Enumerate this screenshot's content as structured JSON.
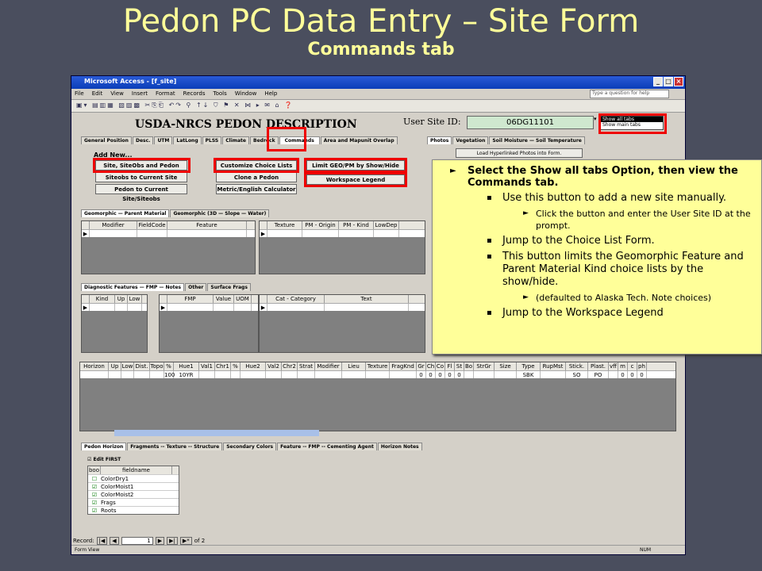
{
  "slide": {
    "title": "Pedon PC Data Entry – Site Form",
    "subtitle": "Commands tab"
  },
  "window": {
    "title": "Microsoft Access - [f_site]",
    "ask_placeholder": "Type a question for help"
  },
  "menu": [
    "File",
    "Edit",
    "View",
    "Insert",
    "Format",
    "Records",
    "Tools",
    "Window",
    "Help"
  ],
  "form": {
    "heading": "USDA-NRCS PEDON DESCRIPTION",
    "user_site_label": "User Site ID:",
    "user_site_value": "06DG11101",
    "tab_options": [
      "Show all tabs",
      "Show main tabs"
    ]
  },
  "tabs": [
    "General Position",
    "Desc.",
    "UTM",
    "LatLong",
    "PLSS",
    "Climate",
    "Bedrock",
    "Commands",
    "Area and Mapunit Overlap"
  ],
  "right_tabs": [
    "Photos",
    "Vegetation",
    "Soil Moisture — Soil Temperature"
  ],
  "photo_button": "Load Hyperlinked Photos into Form.",
  "commands": {
    "add_new": "Add New...",
    "site_obs_btn": "Site, SiteObs and Pedon",
    "siteobs_btn": "Siteobs to Current Site",
    "pedon_btn": "Pedon to Current Site/Siteobs",
    "customize_btn": "Customize Choice Lists",
    "clone_btn": "Clone a Pedon",
    "metric_btn": "Metric/English Calculator",
    "limit_btn": "Limit GEO/PM by Show/Hide",
    "legend_btn": "Workspace Legend"
  },
  "geo_tabs": [
    "Geomorphic — Parent Material",
    "Geomorphic (3D — Slope — Water)"
  ],
  "geo_cols": [
    "Modifier",
    "FieldCode",
    "Feature"
  ],
  "pm_cols": [
    "Texture",
    "PM - Origin",
    "PM - Kind",
    "LowDep"
  ],
  "diag_tabs": [
    "Diagnostic Features — FMP — Notes",
    "Other",
    "Surface Frags"
  ],
  "diag_cols": [
    "Kind",
    "Up",
    "Low"
  ],
  "fmp_cols": [
    "FMP",
    "Value",
    "UOM"
  ],
  "note_cols": [
    "Cat - Category",
    "Text"
  ],
  "horizon": {
    "cols": [
      "Horizon",
      "Up",
      "Low",
      "Dist.",
      "Topo",
      "%",
      "Hue1",
      "Val1",
      "Chr1",
      "%",
      "Hue2",
      "Val2",
      "Chr2",
      "Strat",
      "Modifier",
      "Lieu",
      "Texture",
      "FragKnd",
      "Gr",
      "Ch",
      "Co",
      "Fl",
      "St",
      "Bo",
      "StrGr",
      "Size",
      "Type",
      "RupMst",
      "Stick.",
      "Plast.",
      "vff",
      "m",
      "c",
      "ph"
    ],
    "row": [
      "",
      "",
      "",
      "",
      "",
      "100",
      "10YR",
      "",
      "",
      "",
      "",
      "",
      "",
      "",
      "",
      "",
      "",
      "",
      "0",
      "0",
      "0",
      "0",
      "0",
      "",
      "",
      "",
      "SBK",
      "",
      "SO",
      "PO",
      "",
      "0",
      "0",
      "0"
    ]
  },
  "bottom_tabs": [
    "Pedon Horizon",
    "Fragments -- Texture -- Structure",
    "Secondary Colors",
    "Feature -- FMP -- Cementing Agent",
    "Horizon Notes"
  ],
  "edit_first": "Edit FIRST",
  "field_list": {
    "cols": [
      "boo",
      "fieldname"
    ],
    "rows": [
      "ColorDry1",
      "ColorMoist1",
      "ColorMoist2",
      "Frags",
      "Roots"
    ]
  },
  "record": {
    "label": "Record:",
    "current": "1",
    "of": "of 2"
  },
  "status": {
    "left": "Form View",
    "right": "NUM"
  },
  "callout": {
    "main": "Select the Show all tabs Option, then view the Commands tab.",
    "b1": "Use this button to add a new site manually.",
    "b1s": "Click the button and enter the User Site ID at the prompt.",
    "b2": "Jump to the Choice List Form.",
    "b3": "This button limits the Geomorphic Feature and Parent Material Kind choice lists by the show/hide.",
    "b3s": "(defaulted to Alaska Tech. Note choices)",
    "b4": "Jump to the Workspace Legend"
  }
}
